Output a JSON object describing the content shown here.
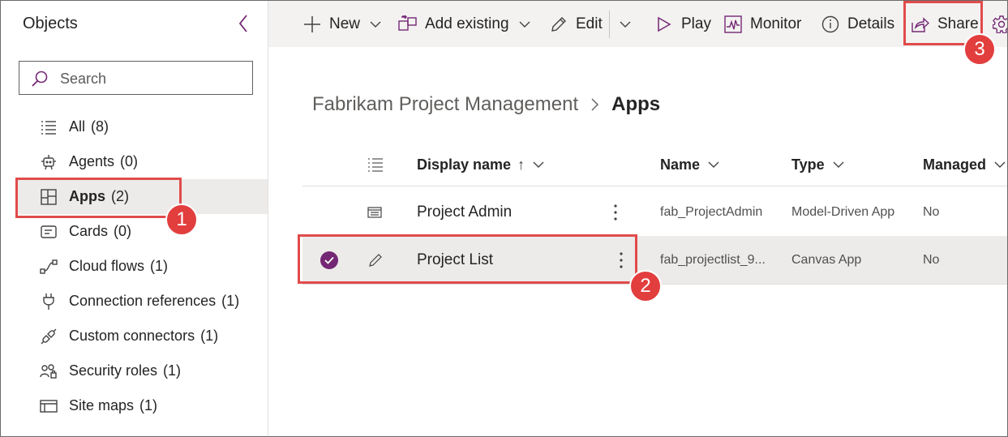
{
  "sidebar": {
    "title": "Objects",
    "search_placeholder": "Search",
    "items": [
      {
        "label": "All",
        "count": "(8)",
        "icon": "list-icon"
      },
      {
        "label": "Agents",
        "count": "(0)",
        "icon": "bot-icon"
      },
      {
        "label": "Apps",
        "count": "(2)",
        "icon": "apps-icon",
        "selected": true
      },
      {
        "label": "Cards",
        "count": "(0)",
        "icon": "card-icon"
      },
      {
        "label": "Cloud flows",
        "count": "(1)",
        "icon": "flow-icon"
      },
      {
        "label": "Connection references",
        "count": "(1)",
        "icon": "plug-icon"
      },
      {
        "label": "Custom connectors",
        "count": "(1)",
        "icon": "connector-icon"
      },
      {
        "label": "Security roles",
        "count": "(1)",
        "icon": "people-icon"
      },
      {
        "label": "Site maps",
        "count": "(1)",
        "icon": "sitemap-icon"
      }
    ]
  },
  "toolbar": {
    "new_label": "New",
    "add_existing_label": "Add existing",
    "edit_label": "Edit",
    "play_label": "Play",
    "monitor_label": "Monitor",
    "details_label": "Details",
    "share_label": "Share"
  },
  "breadcrumb": {
    "parent": "Fabrikam Project Management",
    "current": "Apps"
  },
  "table": {
    "columns": {
      "display_name": "Display name",
      "sort_indicator": "↑",
      "name": "Name",
      "type": "Type",
      "managed": "Managed"
    },
    "rows": [
      {
        "display_name": "Project Admin",
        "name": "fab_ProjectAdmin",
        "type": "Model-Driven App",
        "managed": "No",
        "selected": false
      },
      {
        "display_name": "Project List",
        "name": "fab_projectlist_9...",
        "type": "Canvas App",
        "managed": "No",
        "selected": true
      }
    ]
  },
  "callouts": [
    "1",
    "2",
    "3"
  ],
  "colors": {
    "accent": "#742774",
    "callout": "#e23e3e",
    "selected_bg": "#edebe9",
    "toolbar_bg": "#f3f2f1"
  }
}
